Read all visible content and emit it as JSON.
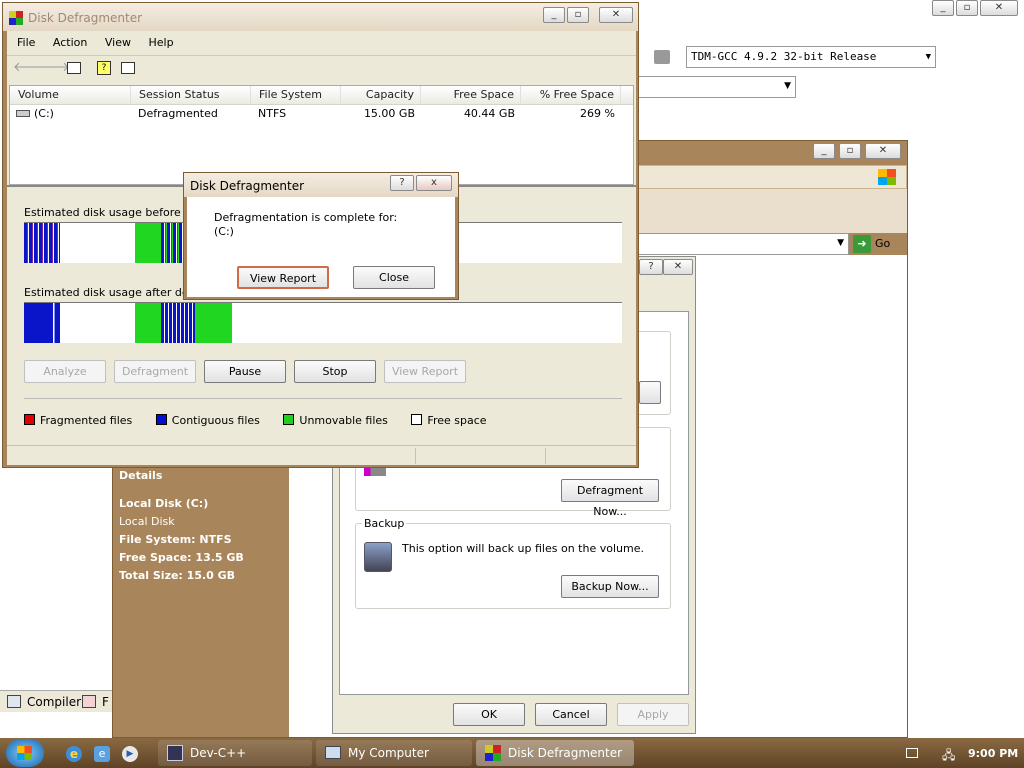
{
  "devcpp": {
    "compiler_combo": "TDM-GCC 4.9.2 32-bit Release",
    "bottom_tabs": [
      "Compiler",
      "F"
    ]
  },
  "properties": {
    "details": {
      "heading": "Details",
      "name": "Local Disk (C:)",
      "type": "Local Disk",
      "fs": "File System: NTFS",
      "free": "Free Space: 13.5 GB",
      "total": "Total Size: 15.0 GB"
    },
    "go_label": "Go",
    "defrag_now": "Defragment Now...",
    "backup": {
      "title": "Backup",
      "text": "This option will back up files on the volume.",
      "button": "Backup Now..."
    },
    "ok": "OK",
    "cancel": "Cancel",
    "apply": "Apply"
  },
  "defrag": {
    "title": "Disk Defragmenter",
    "menu": [
      "File",
      "Action",
      "View",
      "Help"
    ],
    "columns": [
      "Volume",
      "Session Status",
      "File System",
      "Capacity",
      "Free Space",
      "% Free Space"
    ],
    "row": {
      "volume": "(C:)",
      "status": "Defragmented",
      "fs": "NTFS",
      "capacity": "15.00 GB",
      "free": "40.44 GB",
      "pct": "269 %"
    },
    "before_label": "Estimated disk usage before de",
    "after_label": "Estimated disk usage after defra",
    "buttons": {
      "analyze": "Analyze",
      "defragment": "Defragment",
      "pause": "Pause",
      "stop": "Stop",
      "view_report": "View Report"
    },
    "legend": [
      "Fragmented files",
      "Contiguous files",
      "Unmovable files",
      "Free space"
    ],
    "legend_colors": [
      "#e00000",
      "#0010d0",
      "#20d020",
      "#ffffff"
    ]
  },
  "dialog": {
    "title": "Disk Defragmenter",
    "help": "?",
    "close_x": "x",
    "message": "Defragmentation is complete for:",
    "volume": "(C:)",
    "view_report": "View Report",
    "close": "Close"
  },
  "taskbar": {
    "tasks": [
      "Dev-C++",
      "My Computer",
      "Disk Defragmenter"
    ],
    "time": "9:00 PM"
  }
}
